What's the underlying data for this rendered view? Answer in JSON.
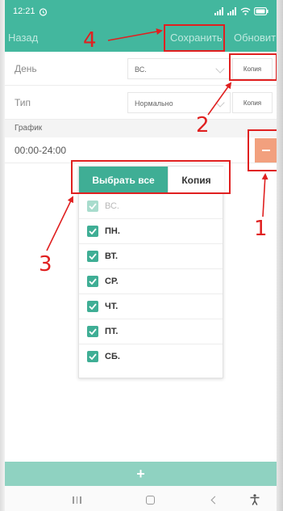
{
  "status_bar": {
    "time": "12:21"
  },
  "appbar": {
    "back_label": "Назад",
    "save_label": "Сохранить",
    "refresh_label": "Обновить"
  },
  "form": {
    "day_label": "День",
    "day_value": "ВС.",
    "day_copy_label": "Копия",
    "type_label": "Тип",
    "type_value": "Нормально",
    "type_copy_label": "Копия"
  },
  "schedule": {
    "header": "График",
    "entry": "00:00-24:00",
    "remove_icon": "minus-icon"
  },
  "popup": {
    "select_all_label": "Выбрать все",
    "copy_label": "Копия",
    "days": [
      {
        "label": "ВС.",
        "checked": true,
        "disabled": true
      },
      {
        "label": "ПН.",
        "checked": true,
        "disabled": false
      },
      {
        "label": "ВТ.",
        "checked": true,
        "disabled": false
      },
      {
        "label": "СР.",
        "checked": true,
        "disabled": false
      },
      {
        "label": "ЧТ.",
        "checked": true,
        "disabled": false
      },
      {
        "label": "ПТ.",
        "checked": true,
        "disabled": false
      },
      {
        "label": "СБ.",
        "checked": true,
        "disabled": false
      }
    ]
  },
  "add_bar": {
    "label": "+"
  },
  "annotations": {
    "n1": "1",
    "n2": "2",
    "n3": "3",
    "n4": "4"
  },
  "colors": {
    "primary": "#43b79e",
    "accent": "#f2a07e",
    "annotation": "#e02020"
  }
}
